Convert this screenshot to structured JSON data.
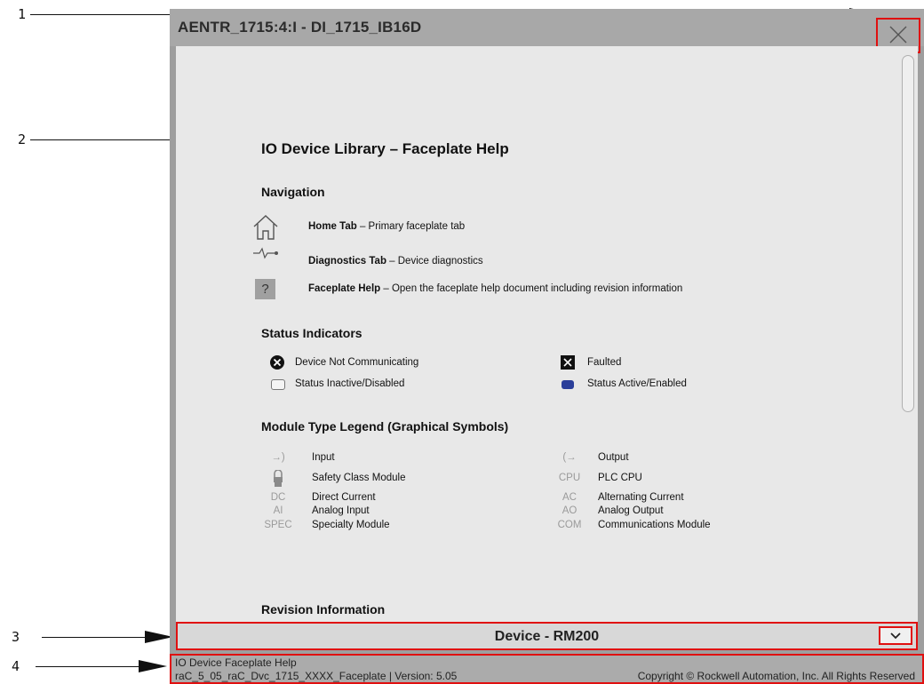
{
  "callouts": [
    "1",
    "2",
    "3",
    "4"
  ],
  "window": {
    "title": "AENTR_1715:4:I - DI_1715_IB16D",
    "close_icon": "close-icon"
  },
  "help": {
    "title": "IO Device Library – Faceplate Help",
    "navigation": {
      "heading": "Navigation",
      "items": [
        {
          "icon": "home-icon",
          "name": "Home Tab",
          "desc": " – Primary faceplate tab"
        },
        {
          "icon": "diagnostics-icon",
          "name": "Diagnostics Tab",
          "desc": " – Device diagnostics"
        },
        {
          "icon": "help-icon",
          "icon_text": "?",
          "name": "Faceplate Help",
          "desc": " – Open the faceplate help document including revision information"
        }
      ]
    },
    "status": {
      "heading": "Status Indicators",
      "items": [
        {
          "icon": "not-communicating-icon",
          "label": "Device Not Communicating"
        },
        {
          "icon": "faulted-icon",
          "label": "Faulted"
        },
        {
          "icon": "status-inactive-icon",
          "label": "Status Inactive/Disabled"
        },
        {
          "icon": "status-active-icon",
          "label": "Status Active/Enabled",
          "color": "#2b3f9a"
        }
      ]
    },
    "legend": {
      "heading": "Module Type Legend (Graphical Symbols)",
      "left": [
        {
          "symbol": "→)",
          "icon": "input-icon",
          "label": "Input"
        },
        {
          "symbol": "",
          "icon": "safety-icon",
          "label": "Safety Class Module"
        },
        {
          "symbol": "DC",
          "label": "Direct Current"
        },
        {
          "symbol": "AI",
          "label": "Analog Input"
        },
        {
          "symbol": "SPEC",
          "label": "Specialty Module"
        }
      ],
      "right": [
        {
          "symbol": "(→",
          "icon": "output-icon",
          "label": "Output"
        },
        {
          "symbol": "CPU",
          "label": "PLC CPU"
        },
        {
          "symbol": "AC",
          "label": "Alternating Current"
        },
        {
          "symbol": "AO",
          "label": "Analog Output"
        },
        {
          "symbol": "COM",
          "label": "Communications Module"
        }
      ]
    },
    "revision_heading": "Revision Information"
  },
  "device_bar": {
    "label": "Device - RM200",
    "icon": "chevron-down-icon"
  },
  "footer": {
    "line1": "IO Device Faceplate Help",
    "line2": "raC_5_05_raC_Dvc_1715_XXXX_Faceplate  |  Version: 5.05",
    "copyright": "Copyright © Rockwell Automation, Inc.  All Rights Reserved"
  },
  "colors": {
    "highlight": "#e01010",
    "title_bar": "#a8a8a8",
    "content_bg": "#e8e8e8",
    "active_status": "#2b3f9a"
  }
}
